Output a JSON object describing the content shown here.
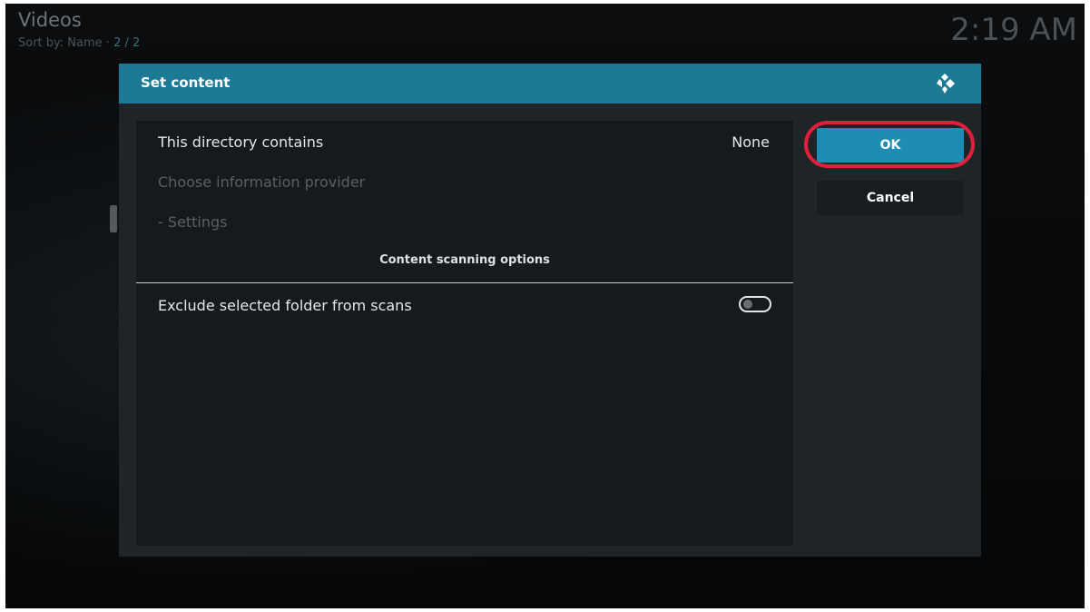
{
  "header": {
    "title": "Videos",
    "sort_label": "Sort by: Name",
    "separator": " · ",
    "count": "2 / 2",
    "clock": "2:19 AM"
  },
  "dialog": {
    "title": "Set content",
    "rows": {
      "directory_label": "This directory contains",
      "directory_value": "None",
      "provider_label": "Choose information provider",
      "settings_label": "- Settings",
      "section_title": "Content scanning options",
      "exclude_label": "Exclude selected folder from scans",
      "exclude_enabled": false
    },
    "buttons": {
      "ok": "OK",
      "cancel": "Cancel"
    }
  },
  "colors": {
    "accent": "#1c7a96",
    "highlight_ring": "#e0203a"
  },
  "icons": [
    "kodi-logo-icon"
  ]
}
